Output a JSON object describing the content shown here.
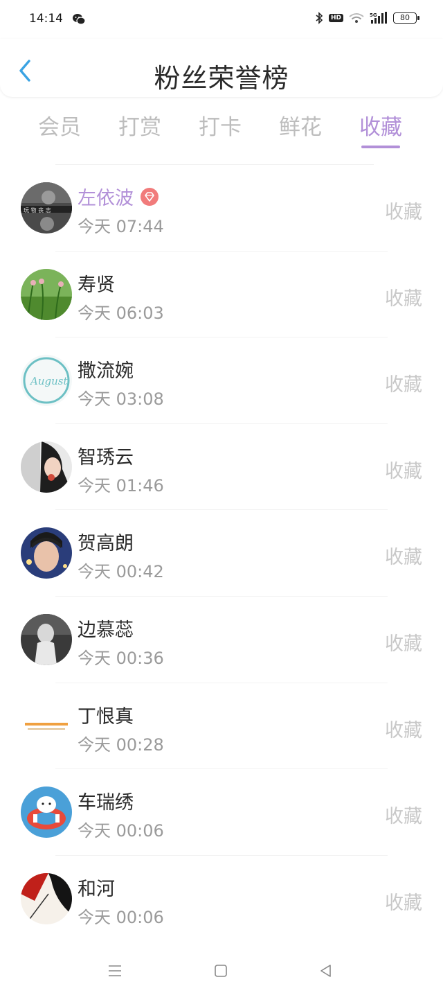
{
  "status_bar": {
    "time": "14:14",
    "battery": "80",
    "hd": "HD",
    "network": "5G"
  },
  "header": {
    "title": "粉丝荣誉榜"
  },
  "tabs": [
    {
      "label": "会员",
      "active": false
    },
    {
      "label": "打赏",
      "active": false
    },
    {
      "label": "打卡",
      "active": false
    },
    {
      "label": "鲜花",
      "active": false
    },
    {
      "label": "收藏",
      "active": true
    }
  ],
  "accent_color": "#b290d8",
  "fans": [
    {
      "name": "左依波",
      "time": "今天 07:44",
      "action": "收藏",
      "vip": true
    },
    {
      "name": "寿贤",
      "time": "今天 06:03",
      "action": "收藏",
      "vip": false
    },
    {
      "name": "撒流婉",
      "time": "今天 03:08",
      "action": "收藏",
      "vip": false
    },
    {
      "name": "智琇云",
      "time": "今天 01:46",
      "action": "收藏",
      "vip": false
    },
    {
      "name": "贺高朗",
      "time": "今天 00:42",
      "action": "收藏",
      "vip": false
    },
    {
      "name": "边慕蕊",
      "time": "今天 00:36",
      "action": "收藏",
      "vip": false
    },
    {
      "name": "丁恨真",
      "time": "今天 00:28",
      "action": "收藏",
      "vip": false
    },
    {
      "name": "车瑞绣",
      "time": "今天 00:06",
      "action": "收藏",
      "vip": false
    },
    {
      "name": "和河",
      "time": "今天 00:06",
      "action": "收藏",
      "vip": false
    }
  ],
  "nav_icons": [
    "menu-icon",
    "home-icon",
    "back-triangle-icon"
  ]
}
